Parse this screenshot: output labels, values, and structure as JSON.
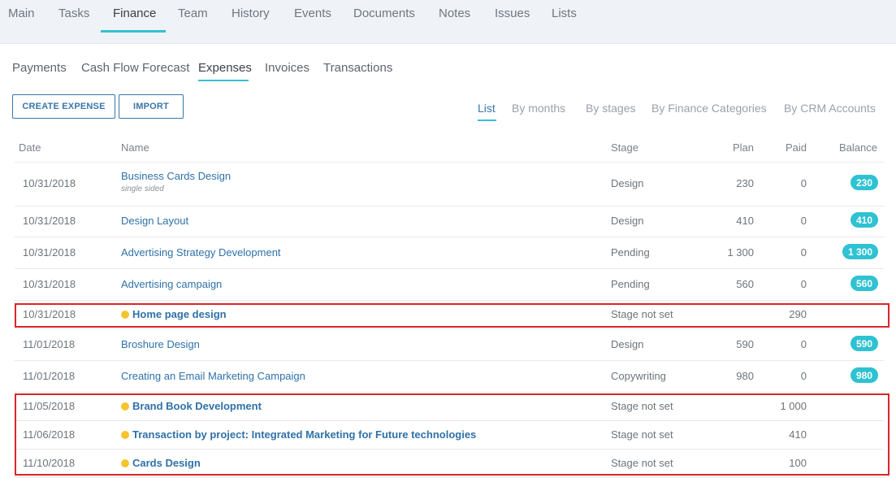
{
  "top_tabs": [
    "Main",
    "Tasks",
    "Finance",
    "Team",
    "History",
    "Events",
    "Documents",
    "Notes",
    "Issues",
    "Lists"
  ],
  "sub_tabs": [
    "Payments",
    "Cash Flow Forecast",
    "Expenses",
    "Invoices",
    "Transactions"
  ],
  "buttons": {
    "create": "CREATE EXPENSE",
    "import": "IMPORT"
  },
  "view_tabs": [
    "List",
    "By months",
    "By stages",
    "By Finance Categories",
    "By CRM Accounts"
  ],
  "columns": {
    "date": "Date",
    "name": "Name",
    "stage": "Stage",
    "plan": "Plan",
    "paid": "Paid",
    "balance": "Balance"
  },
  "rows": [
    {
      "date": "10/31/2018",
      "name": "Business Cards Design",
      "note": "single sided",
      "stage": "Design",
      "plan": "230",
      "paid": "0",
      "balance": "230"
    },
    {
      "date": "10/31/2018",
      "name": "Design Layout",
      "stage": "Design",
      "plan": "410",
      "paid": "0",
      "balance": "410"
    },
    {
      "date": "10/31/2018",
      "name": "Advertising Strategy Development",
      "stage": "Pending",
      "plan": "1 300",
      "paid": "0",
      "balance": "1 300"
    },
    {
      "date": "10/31/2018",
      "name": "Advertising campaign",
      "stage": "Pending",
      "plan": "560",
      "paid": "0",
      "balance": "560"
    },
    {
      "date": "10/31/2018",
      "name": "Home page design",
      "stage": "Stage not set",
      "plan": "",
      "paid": "290",
      "balance": "",
      "transaction": true
    },
    {
      "date": "11/01/2018",
      "name": "Broshure Design",
      "stage": "Design",
      "plan": "590",
      "paid": "0",
      "balance": "590"
    },
    {
      "date": "11/01/2018",
      "name": "Creating an Email Marketing Campaign",
      "stage": "Copywriting",
      "plan": "980",
      "paid": "0",
      "balance": "980"
    },
    {
      "date": "11/05/2018",
      "name": "Brand Book Development",
      "stage": "Stage not set",
      "plan": "",
      "paid": "1 000",
      "balance": "",
      "transaction": true
    },
    {
      "date": "11/06/2018",
      "name": "Transaction by project: Integrated Marketing for Future technologies",
      "stage": "Stage not set",
      "plan": "",
      "paid": "410",
      "balance": "",
      "transaction": true
    },
    {
      "date": "11/10/2018",
      "name": "Cards Design",
      "stage": "Stage not set",
      "plan": "",
      "paid": "100",
      "balance": "",
      "transaction": true
    }
  ],
  "colors": {
    "accent": "#37bfd0",
    "link": "#2f71a8",
    "badge": "#2ec2d3",
    "dot": "#f4c430",
    "highlight": "#d9262b"
  },
  "icons": {
    "transaction_marker": "yellow-dot-icon"
  }
}
